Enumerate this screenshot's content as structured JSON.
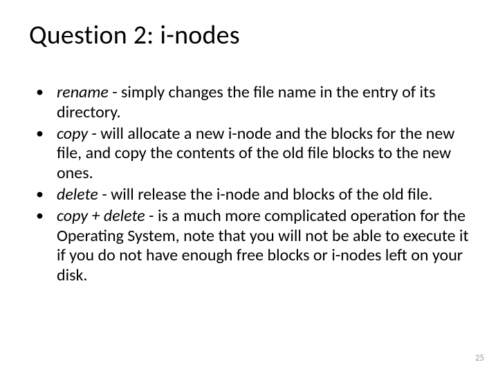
{
  "title": "Question 2: i-nodes",
  "bullets": [
    {
      "term": "rename",
      "rest": " - simply changes the file name in the entry of  its directory."
    },
    {
      "term": "copy",
      "rest": " -  will allocate a new i-node and the blocks for the new file, and copy the contents of the old file blocks to the new ones."
    },
    {
      "term": "delete",
      "rest": " - will release the i-node and blocks of the old file."
    },
    {
      "term": "copy + delete",
      "rest": " - is a much more complicated operation for the Operating System, note that you will not be able to execute it if you do not have enough free blocks or i-nodes left on your disk."
    }
  ],
  "page_number": "25"
}
